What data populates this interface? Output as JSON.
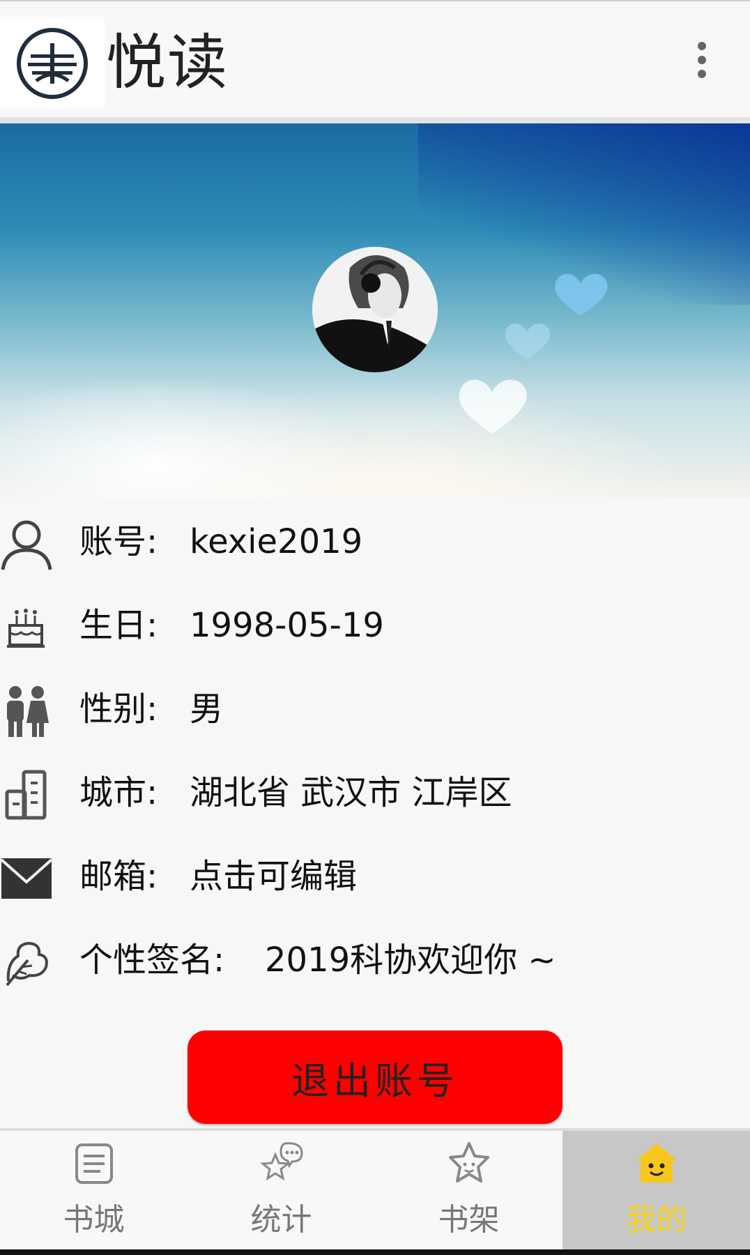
{
  "app": {
    "title": "悦读"
  },
  "profile": {
    "fields": [
      {
        "icon": "user-icon",
        "label": "账号:",
        "value": "kexie2019"
      },
      {
        "icon": "birthday-cake-icon",
        "label": "生日:",
        "value": "1998-05-19"
      },
      {
        "icon": "gender-icon",
        "label": "性别:",
        "value": "男"
      },
      {
        "icon": "city-building-icon",
        "label": "城市:",
        "value": "湖北省 武汉市 江岸区"
      },
      {
        "icon": "mail-icon",
        "label": "邮箱:",
        "value": "点击可编辑"
      },
      {
        "icon": "signature-leaf-icon",
        "label": "个性签名:",
        "value": "2019科协欢迎你 ~"
      }
    ],
    "logout_label": "退出账号"
  },
  "tabs": [
    {
      "icon": "book-list-icon",
      "label": "书城",
      "active": false
    },
    {
      "icon": "chat-star-icon",
      "label": "统计",
      "active": false
    },
    {
      "icon": "star-icon",
      "label": "书架",
      "active": false
    },
    {
      "icon": "smile-home-icon",
      "label": "我的",
      "active": true
    }
  ],
  "colors": {
    "logout_button": "#ff0000",
    "active_tab_bg": "#c7c7c7",
    "active_tab_label": "#f7d21d",
    "inactive_tab_label": "#777777"
  }
}
